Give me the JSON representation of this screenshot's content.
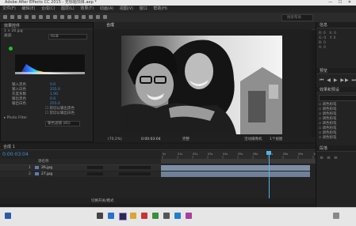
{
  "window": {
    "title": "Adobe After Effects CC 2015 - 无标题项目.aep *",
    "controls": "— ☐ ✕"
  },
  "menu": [
    "文件(F)",
    "编辑(E)",
    "合成(C)",
    "图层(L)",
    "效果(T)",
    "动画(A)",
    "视图(V)",
    "窗口",
    "帮助(H)"
  ],
  "search": {
    "placeholder": "搜索帮助"
  },
  "left_panel": {
    "title": "1 × 26.jpg",
    "tab": "效果控件",
    "channel": "RGB",
    "rows": [
      {
        "label": "输入黑色",
        "value": "0.0"
      },
      {
        "label": "输入白色",
        "value": "255.0"
      },
      {
        "label": "灰度系数",
        "value": "1.00"
      },
      {
        "label": "输出黑色",
        "value": "0.0"
      },
      {
        "label": "输出白色",
        "value": "255.0"
      }
    ],
    "clip_black": "剪切以输出黑色",
    "clip_white": "剪切以输出白色",
    "filter_label": "Photo Filter",
    "filter_value": "暖色滤镜 (85)"
  },
  "viewer": {
    "tab": "合成",
    "zoom": "(70.2%)",
    "timecode": "0:00:03:04",
    "quality": "完整",
    "camera": "活动摄像机",
    "views": "1个视图"
  },
  "timeline": {
    "tab": "合成 1",
    "timecode": "0:00:03:04",
    "col_name": "源名称",
    "layers": [
      {
        "num": "1",
        "name": "26.jpg"
      },
      {
        "num": "2",
        "name": "27.jpg"
      }
    ],
    "footer": "切换开关/模式",
    "ruler": [
      "0s",
      "01s",
      "02s",
      "03s",
      "04s",
      "05s",
      "06s",
      "07s",
      "08s",
      "09s",
      "10s"
    ]
  },
  "right_panel": {
    "info_tab": "信息",
    "preview_tab": "预览",
    "effects_tab": "效果和预设",
    "effects_items": [
      "调色粉笔",
      "调色粉笔",
      "调色粉笔",
      "调色粉笔",
      "调色粉笔",
      "调色粉笔",
      "调色粉笔",
      "调色粉笔"
    ],
    "paragraph_tab": "段落"
  },
  "colors": {
    "accent": "#3d8fd1",
    "keyframe_line": "#52b2e8",
    "track": "#5e7bb2"
  }
}
